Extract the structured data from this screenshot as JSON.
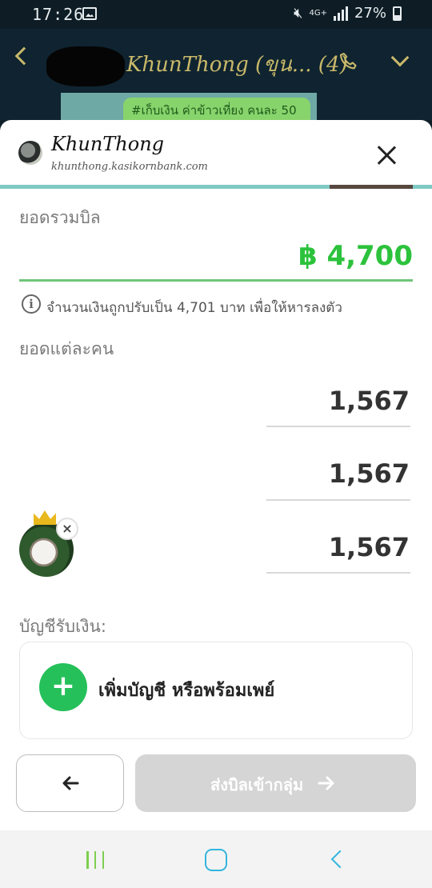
{
  "status_bar": {
    "time": "17:26",
    "network": "4G+",
    "battery": "27%",
    "icons": [
      "image-icon",
      "mute-icon",
      "signal-icon",
      "battery-icon"
    ]
  },
  "chat_header": {
    "title": "KhunThong (ขุน... (4)",
    "banner_text": "#เก็บเงิน ค่าข้าวเที่ยง คนละ 50"
  },
  "sheet": {
    "brand_name": "KhunThong",
    "brand_url": "khunthong.kasikornbank.com",
    "total_label": "ยอดรวมบิล",
    "total_amount": "฿ 4,700",
    "adjust_note": "จำนวนเงินถูกปรับเป็น 4,701 บาท เพื่อให้หารลงตัว",
    "per_person_label": "ยอดแต่ละคน",
    "per_person_values": [
      "1,567",
      "1,567",
      "1,567"
    ],
    "remove_symbol": "×",
    "account_label": "บัญชีรับเงิน:",
    "add_account_label": "เพิ่มบัญชี หรือพร้อมเพย์",
    "plus_symbol": "+",
    "send_label": "ส่งบิลเข้ากลุ่ม",
    "info_symbol": "i"
  },
  "colors": {
    "accent_green": "#2cc23c",
    "progress_teal": "#7ec9c3",
    "nav_green": "#7ccf4e",
    "nav_blue": "#33b6dd",
    "disabled_button": "#d5d5d5"
  }
}
